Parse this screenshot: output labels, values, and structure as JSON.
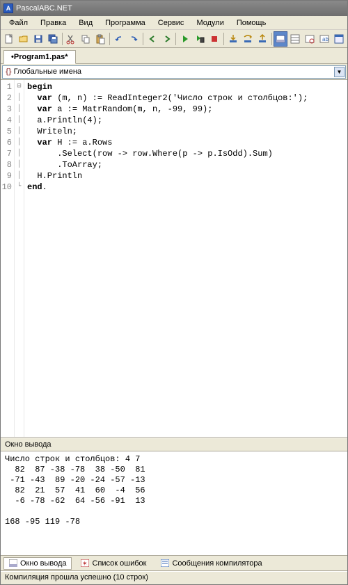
{
  "title": "PascalABC.NET",
  "menu": [
    "Файл",
    "Правка",
    "Вид",
    "Программа",
    "Сервис",
    "Модули",
    "Помощь"
  ],
  "tab": "•Program1.pas*",
  "combo": "Глобальные имена",
  "code": {
    "l1a": "begin",
    "l2a": "  ",
    "l2b": "var",
    "l2c": " (m, n) := ReadInteger2(",
    "l2d": "'Число строк и столбцов:'",
    "l2e": ");",
    "l3a": "  ",
    "l3b": "var",
    "l3c": " a := MatrRandom(m, n, -99, 99);",
    "l4": "  a.Println(4);",
    "l5": "  Writeln;",
    "l6a": "  ",
    "l6b": "var",
    "l6c": " H := a.Rows",
    "l7": "      .Select(row -> row.Where(p -> p.IsOdd).Sum)",
    "l8": "      .ToArray;",
    "l9": "  H.Println",
    "l10a": "end",
    "l10b": "."
  },
  "lines": [
    "1",
    "2",
    "3",
    "4",
    "5",
    "6",
    "7",
    "8",
    "9",
    "10"
  ],
  "outputPanelTitle": "Окно вывода",
  "output": "Число строк и столбцов: 4 7\n  82  87 -38 -78  38 -50  81\n -71 -43  89 -20 -24 -57 -13\n  82  21  57  41  60  -4  56\n  -6 -78 -62  64 -56 -91  13\n\n168 -95 119 -78",
  "bottomTabs": {
    "output": "Окно вывода",
    "errors": "Список ошибок",
    "messages": "Сообщения компилятора"
  },
  "status": "Компиляция прошла успешно (10 строк)"
}
